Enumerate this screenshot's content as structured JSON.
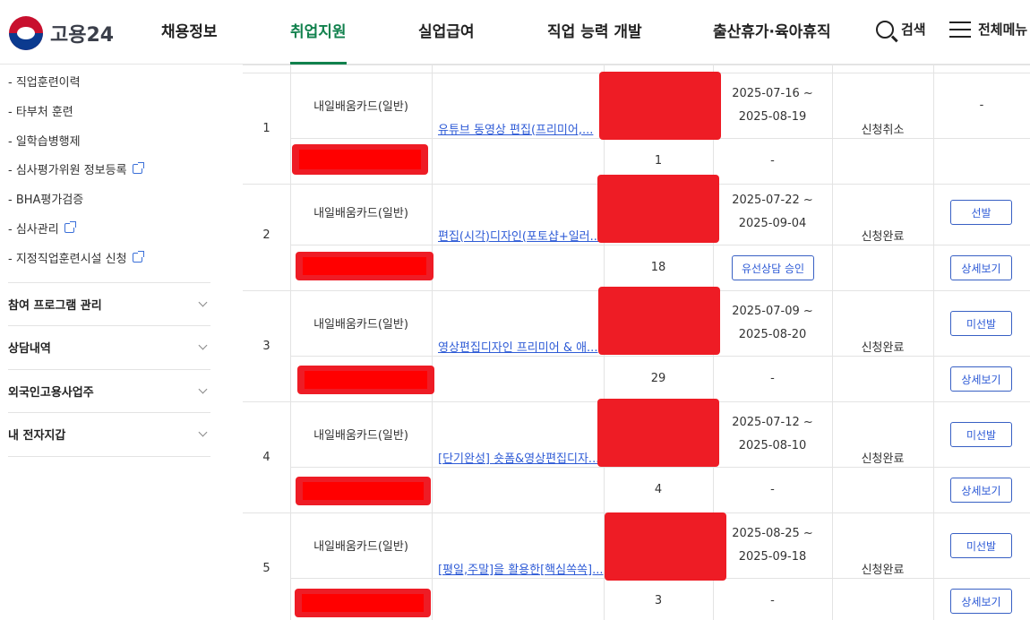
{
  "header": {
    "logo_text": "고용24",
    "nav": [
      "채용정보",
      "취업지원",
      "실업급여",
      "직업 능력 개발",
      "출산휴가·육아휴직"
    ],
    "active_nav": "취업지원",
    "search_label": "검색",
    "menu_label": "전체메뉴"
  },
  "sidebar": {
    "sub_items": [
      {
        "label": "- 직업훈련이력",
        "external": false
      },
      {
        "label": "- 타부처 훈련",
        "external": false
      },
      {
        "label": "- 일학습병행제",
        "external": false
      },
      {
        "label": "- 심사평가위원 정보등록",
        "external": true
      },
      {
        "label": "- BHA평가검증",
        "external": false
      },
      {
        "label": "- 심사관리",
        "external": true
      },
      {
        "label": "- 지정직업훈련시설 신청",
        "external": true
      }
    ],
    "groups": [
      "참여 프로그램 관리",
      "상담내역",
      "외국인고용사업주",
      "내 전자지갑"
    ]
  },
  "table": {
    "rows": [
      {
        "no": "1",
        "card_type": "내일배움카드(일반)",
        "course": "유튜브 동영상 편집(프리미어,...",
        "period_start": "2025-07-16 ~",
        "period_end": "2025-08-19",
        "count": "1",
        "consult": "-",
        "status": "신청취소",
        "select": "-",
        "detail": ""
      },
      {
        "no": "2",
        "card_type": "내일배움카드(일반)",
        "course": "편집(시각)디자인(포토샵+일러...",
        "period_start": "2025-07-22 ~",
        "period_end": "2025-09-04",
        "count": "18",
        "consult": "유선상담 승인",
        "status": "신청완료",
        "select": "선발",
        "detail": "상세보기"
      },
      {
        "no": "3",
        "card_type": "내일배움카드(일반)",
        "course": "영상편집디자인 프리미어 & 애...",
        "period_start": "2025-07-09 ~",
        "period_end": "2025-08-20",
        "count": "29",
        "consult": "-",
        "status": "신청완료",
        "select": "미선발",
        "detail": "상세보기"
      },
      {
        "no": "4",
        "card_type": "내일배움카드(일반)",
        "course": "[단기완성] 숏폼&영상편집디자...",
        "period_start": "2025-07-12 ~",
        "period_end": "2025-08-10",
        "count": "4",
        "consult": "-",
        "status": "신청완료",
        "select": "미선발",
        "detail": "상세보기"
      },
      {
        "no": "5",
        "card_type": "내일배움카드(일반)",
        "course": "[평일,주말]을 활용한[핵심쏙쏙]...",
        "period_start": "2025-08-25 ~",
        "period_end": "2025-09-18",
        "count": "3",
        "consult": "-",
        "status": "신청완료",
        "select": "미선발",
        "detail": "상세보기"
      }
    ]
  },
  "colors": {
    "accent": "#11814d",
    "link": "#2e5bd6",
    "redaction": "#ee1c25"
  }
}
